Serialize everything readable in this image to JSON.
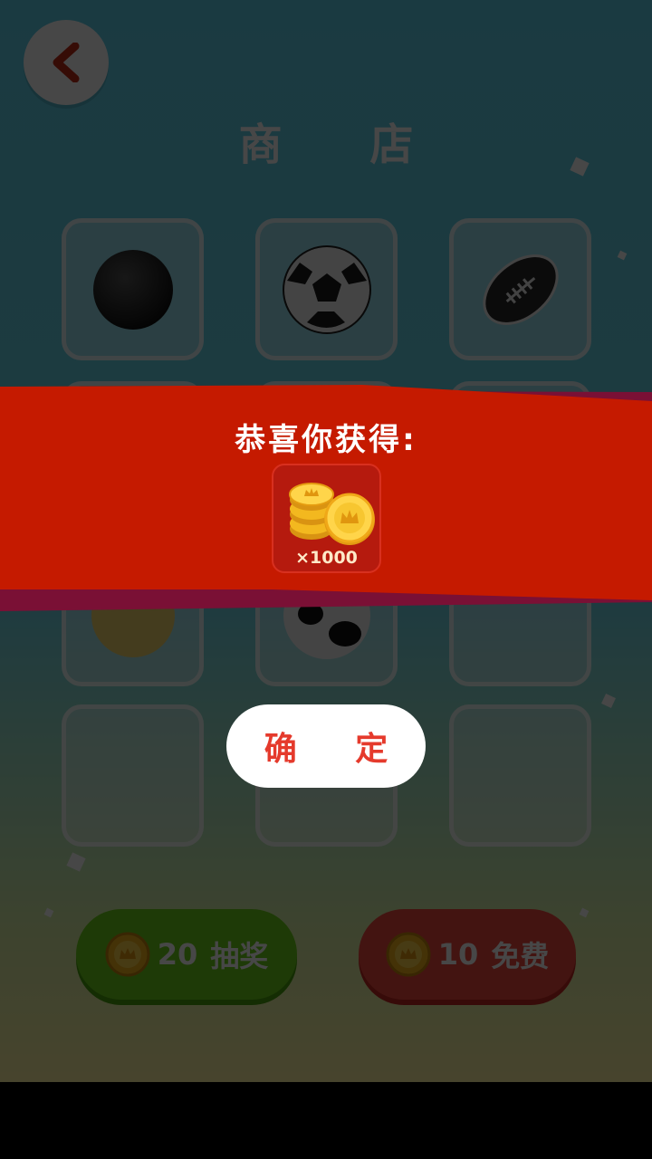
{
  "header": {
    "title": "商 店",
    "back_icon": "chevron-left-icon"
  },
  "shop": {
    "items": [
      {
        "icon": "black-ball-icon"
      },
      {
        "icon": "soccer-ball-icon"
      },
      {
        "icon": "rugby-ball-icon"
      },
      {
        "icon": "locked-slot"
      },
      {
        "icon": "locked-slot"
      },
      {
        "icon": "locked-slot"
      },
      {
        "icon": "striped-ball-icon"
      },
      {
        "icon": "panda-ball-icon"
      },
      {
        "icon": "empty-slot"
      },
      {
        "icon": "empty-slot"
      },
      {
        "icon": "empty-slot"
      },
      {
        "icon": "empty-slot"
      }
    ]
  },
  "actions": {
    "lottery": {
      "amount": "20",
      "label": "抽奖",
      "color": "#6ed11a"
    },
    "free": {
      "amount": "10",
      "label": "免费",
      "color": "#f04a3d"
    }
  },
  "reward_dialog": {
    "title": "恭喜你获得:",
    "reward_icon": "gold-coins-icon",
    "quantity": "×1000",
    "confirm_label": "确 定",
    "ribbon_color": "#c51a00",
    "ribbon_shadow_color": "#7a1035"
  }
}
